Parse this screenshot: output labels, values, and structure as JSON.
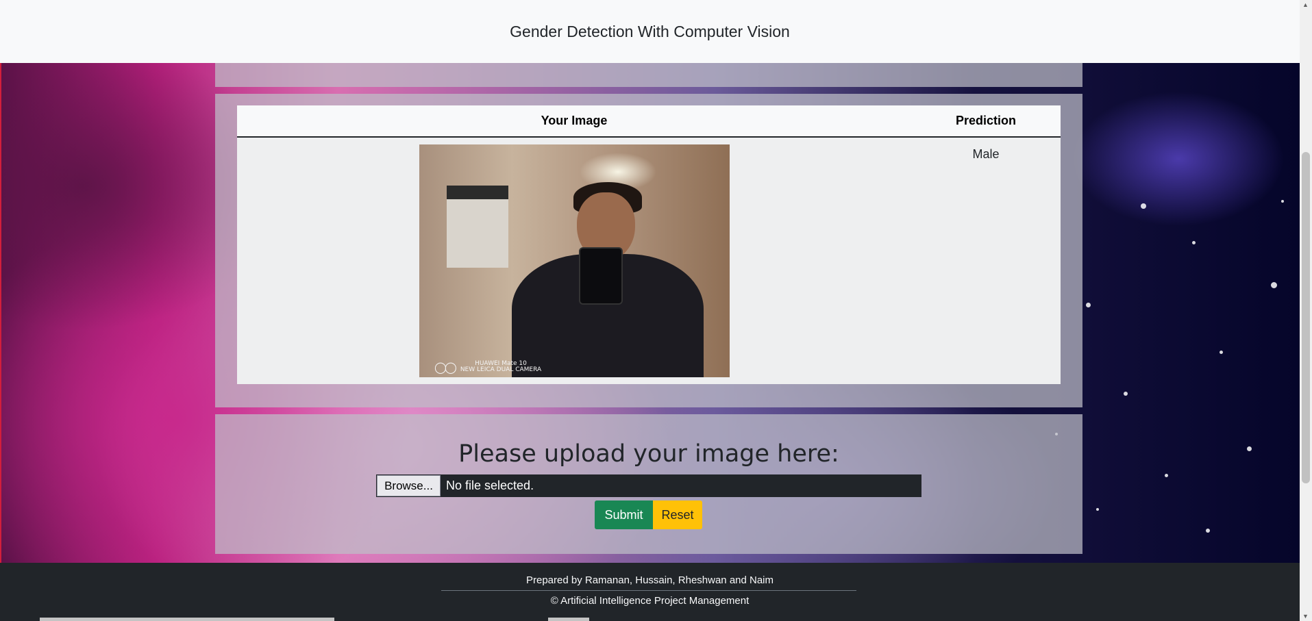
{
  "navbar": {
    "brand": "Gender Detection With Computer Vision"
  },
  "results": {
    "headers": [
      "Your Image",
      "Prediction"
    ],
    "rows": [
      {
        "image_watermark_line1": "HUAWEI Mate 10",
        "image_watermark_line2": "NEW LEICA DUAL CAMERA",
        "prediction": "Male"
      }
    ]
  },
  "upload": {
    "heading": "Please upload your image here:",
    "browse_label": "Browse...",
    "file_status": "No file selected.",
    "submit_label": "Submit",
    "reset_label": "Reset"
  },
  "footer": {
    "credits": "Prepared by Ramanan, Hussain, Rheshwan and Naim",
    "copyright": "© Artificial Intelligence Project Management"
  },
  "colors": {
    "submit": "#198754",
    "reset": "#ffc107",
    "footer_bg": "#212529",
    "navbar_bg": "#f8f9fa"
  }
}
